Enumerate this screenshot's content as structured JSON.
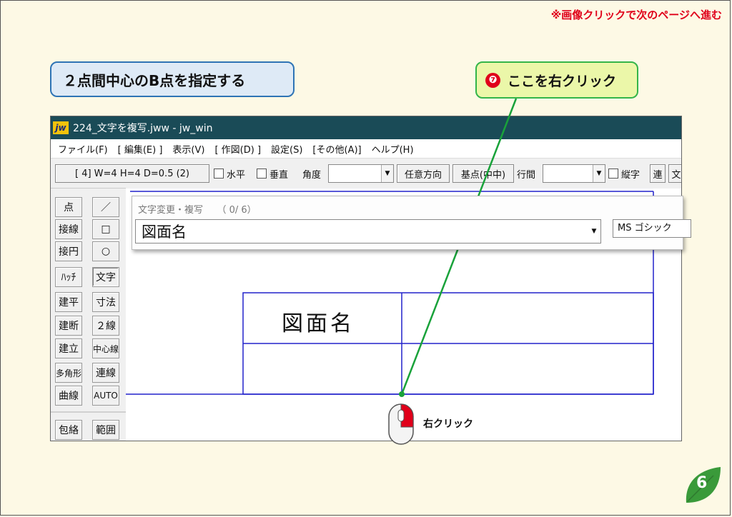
{
  "header": {
    "nav_note": "※画像クリックで次のページへ進む"
  },
  "step": {
    "label": "２点間中心のB点を指定する"
  },
  "callout": {
    "number": "❼",
    "text": "ここを右クリック",
    "right_click_label": "右クリック"
  },
  "window": {
    "title": "224_文字を複写.jww - jw_win",
    "logo": "jw"
  },
  "menu": [
    "ファイル(F)",
    "[ 編集(E) ]",
    "表示(V)",
    "[ 作図(D) ]",
    "設定(S)",
    "[その他(A)]",
    "ヘルプ(H)"
  ],
  "toolbar": {
    "status": "[ 4]  W=4  H=4  D=0.5 (2)",
    "horizontal": "水平",
    "vertical": "垂直",
    "angle": "角度",
    "arbitrary_direction": "任意方向",
    "base_point": "基点(中中)",
    "line_spacing": "行間",
    "vertical_text": "縦字",
    "continuous": "連",
    "text_cut": "文"
  },
  "sidebar": {
    "left": [
      "点",
      "接線",
      "接円",
      "ﾊｯﾁ",
      "建平",
      "建断",
      "建立",
      "多角形",
      "曲線",
      "包絡"
    ],
    "right": [
      "／",
      "□",
      "○",
      "文字",
      "寸法",
      "２線",
      "中心線",
      "連線",
      "AUTO",
      "範囲"
    ]
  },
  "dialog": {
    "title": "文字変更・複写　　（ 0/ 6）",
    "value": "図面名",
    "font": "MS ゴシック"
  },
  "drawing": {
    "cell_text": "図面名"
  },
  "page": {
    "number": "6"
  },
  "colors": {
    "accent_red": "#e0001a",
    "step_border": "#2e74b5",
    "callout_border": "#33b54a",
    "drawing_line": "#2222cc",
    "titlebar": "#1a4b57"
  }
}
